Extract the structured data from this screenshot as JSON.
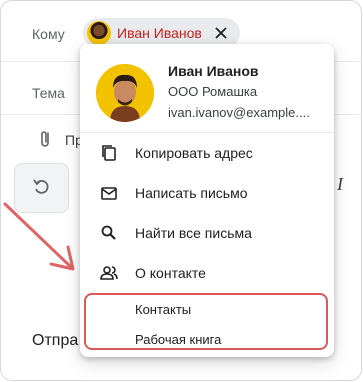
{
  "compose": {
    "to_label": "Кому",
    "subject_label": "Тема",
    "attach_text": "Пр",
    "send_text": "Отпра"
  },
  "recipient_chip": {
    "name": "Иван Иванов",
    "name_color": "#c5221f"
  },
  "contact_card": {
    "name": "Иван Иванов",
    "company": "ООО Ромашка",
    "email": "ivan.ivanov@example...."
  },
  "menu": {
    "items": [
      {
        "label": "Копировать адрес",
        "icon": "copy-icon"
      },
      {
        "label": "Написать письмо",
        "icon": "mail-icon"
      },
      {
        "label": "Найти все письма",
        "icon": "search-icon"
      },
      {
        "label": "О контакте",
        "icon": "contact-info-icon"
      }
    ],
    "highlighted_items": [
      {
        "label": "Контакты"
      },
      {
        "label": "Рабочая книга"
      }
    ]
  },
  "annotation": {
    "arrow_color": "#e06666",
    "highlight_color": "#d85a5a"
  }
}
